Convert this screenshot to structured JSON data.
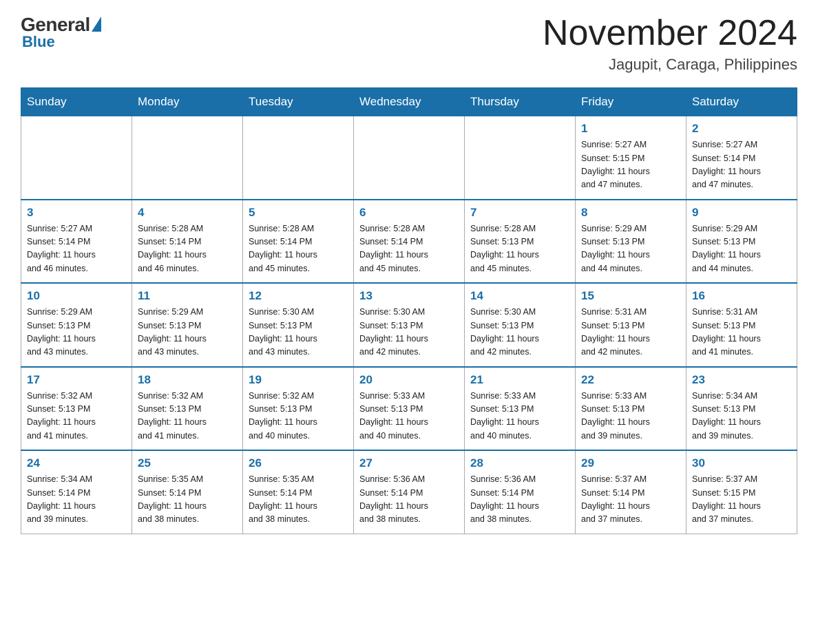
{
  "header": {
    "logo": {
      "general": "General",
      "blue": "Blue"
    },
    "title": "November 2024",
    "location": "Jagupit, Caraga, Philippines"
  },
  "weekdays": [
    "Sunday",
    "Monday",
    "Tuesday",
    "Wednesday",
    "Thursday",
    "Friday",
    "Saturday"
  ],
  "weeks": [
    [
      {
        "day": "",
        "info": ""
      },
      {
        "day": "",
        "info": ""
      },
      {
        "day": "",
        "info": ""
      },
      {
        "day": "",
        "info": ""
      },
      {
        "day": "",
        "info": ""
      },
      {
        "day": "1",
        "info": "Sunrise: 5:27 AM\nSunset: 5:15 PM\nDaylight: 11 hours\nand 47 minutes."
      },
      {
        "day": "2",
        "info": "Sunrise: 5:27 AM\nSunset: 5:14 PM\nDaylight: 11 hours\nand 47 minutes."
      }
    ],
    [
      {
        "day": "3",
        "info": "Sunrise: 5:27 AM\nSunset: 5:14 PM\nDaylight: 11 hours\nand 46 minutes."
      },
      {
        "day": "4",
        "info": "Sunrise: 5:28 AM\nSunset: 5:14 PM\nDaylight: 11 hours\nand 46 minutes."
      },
      {
        "day": "5",
        "info": "Sunrise: 5:28 AM\nSunset: 5:14 PM\nDaylight: 11 hours\nand 45 minutes."
      },
      {
        "day": "6",
        "info": "Sunrise: 5:28 AM\nSunset: 5:14 PM\nDaylight: 11 hours\nand 45 minutes."
      },
      {
        "day": "7",
        "info": "Sunrise: 5:28 AM\nSunset: 5:13 PM\nDaylight: 11 hours\nand 45 minutes."
      },
      {
        "day": "8",
        "info": "Sunrise: 5:29 AM\nSunset: 5:13 PM\nDaylight: 11 hours\nand 44 minutes."
      },
      {
        "day": "9",
        "info": "Sunrise: 5:29 AM\nSunset: 5:13 PM\nDaylight: 11 hours\nand 44 minutes."
      }
    ],
    [
      {
        "day": "10",
        "info": "Sunrise: 5:29 AM\nSunset: 5:13 PM\nDaylight: 11 hours\nand 43 minutes."
      },
      {
        "day": "11",
        "info": "Sunrise: 5:29 AM\nSunset: 5:13 PM\nDaylight: 11 hours\nand 43 minutes."
      },
      {
        "day": "12",
        "info": "Sunrise: 5:30 AM\nSunset: 5:13 PM\nDaylight: 11 hours\nand 43 minutes."
      },
      {
        "day": "13",
        "info": "Sunrise: 5:30 AM\nSunset: 5:13 PM\nDaylight: 11 hours\nand 42 minutes."
      },
      {
        "day": "14",
        "info": "Sunrise: 5:30 AM\nSunset: 5:13 PM\nDaylight: 11 hours\nand 42 minutes."
      },
      {
        "day": "15",
        "info": "Sunrise: 5:31 AM\nSunset: 5:13 PM\nDaylight: 11 hours\nand 42 minutes."
      },
      {
        "day": "16",
        "info": "Sunrise: 5:31 AM\nSunset: 5:13 PM\nDaylight: 11 hours\nand 41 minutes."
      }
    ],
    [
      {
        "day": "17",
        "info": "Sunrise: 5:32 AM\nSunset: 5:13 PM\nDaylight: 11 hours\nand 41 minutes."
      },
      {
        "day": "18",
        "info": "Sunrise: 5:32 AM\nSunset: 5:13 PM\nDaylight: 11 hours\nand 41 minutes."
      },
      {
        "day": "19",
        "info": "Sunrise: 5:32 AM\nSunset: 5:13 PM\nDaylight: 11 hours\nand 40 minutes."
      },
      {
        "day": "20",
        "info": "Sunrise: 5:33 AM\nSunset: 5:13 PM\nDaylight: 11 hours\nand 40 minutes."
      },
      {
        "day": "21",
        "info": "Sunrise: 5:33 AM\nSunset: 5:13 PM\nDaylight: 11 hours\nand 40 minutes."
      },
      {
        "day": "22",
        "info": "Sunrise: 5:33 AM\nSunset: 5:13 PM\nDaylight: 11 hours\nand 39 minutes."
      },
      {
        "day": "23",
        "info": "Sunrise: 5:34 AM\nSunset: 5:13 PM\nDaylight: 11 hours\nand 39 minutes."
      }
    ],
    [
      {
        "day": "24",
        "info": "Sunrise: 5:34 AM\nSunset: 5:14 PM\nDaylight: 11 hours\nand 39 minutes."
      },
      {
        "day": "25",
        "info": "Sunrise: 5:35 AM\nSunset: 5:14 PM\nDaylight: 11 hours\nand 38 minutes."
      },
      {
        "day": "26",
        "info": "Sunrise: 5:35 AM\nSunset: 5:14 PM\nDaylight: 11 hours\nand 38 minutes."
      },
      {
        "day": "27",
        "info": "Sunrise: 5:36 AM\nSunset: 5:14 PM\nDaylight: 11 hours\nand 38 minutes."
      },
      {
        "day": "28",
        "info": "Sunrise: 5:36 AM\nSunset: 5:14 PM\nDaylight: 11 hours\nand 38 minutes."
      },
      {
        "day": "29",
        "info": "Sunrise: 5:37 AM\nSunset: 5:14 PM\nDaylight: 11 hours\nand 37 minutes."
      },
      {
        "day": "30",
        "info": "Sunrise: 5:37 AM\nSunset: 5:15 PM\nDaylight: 11 hours\nand 37 minutes."
      }
    ]
  ]
}
